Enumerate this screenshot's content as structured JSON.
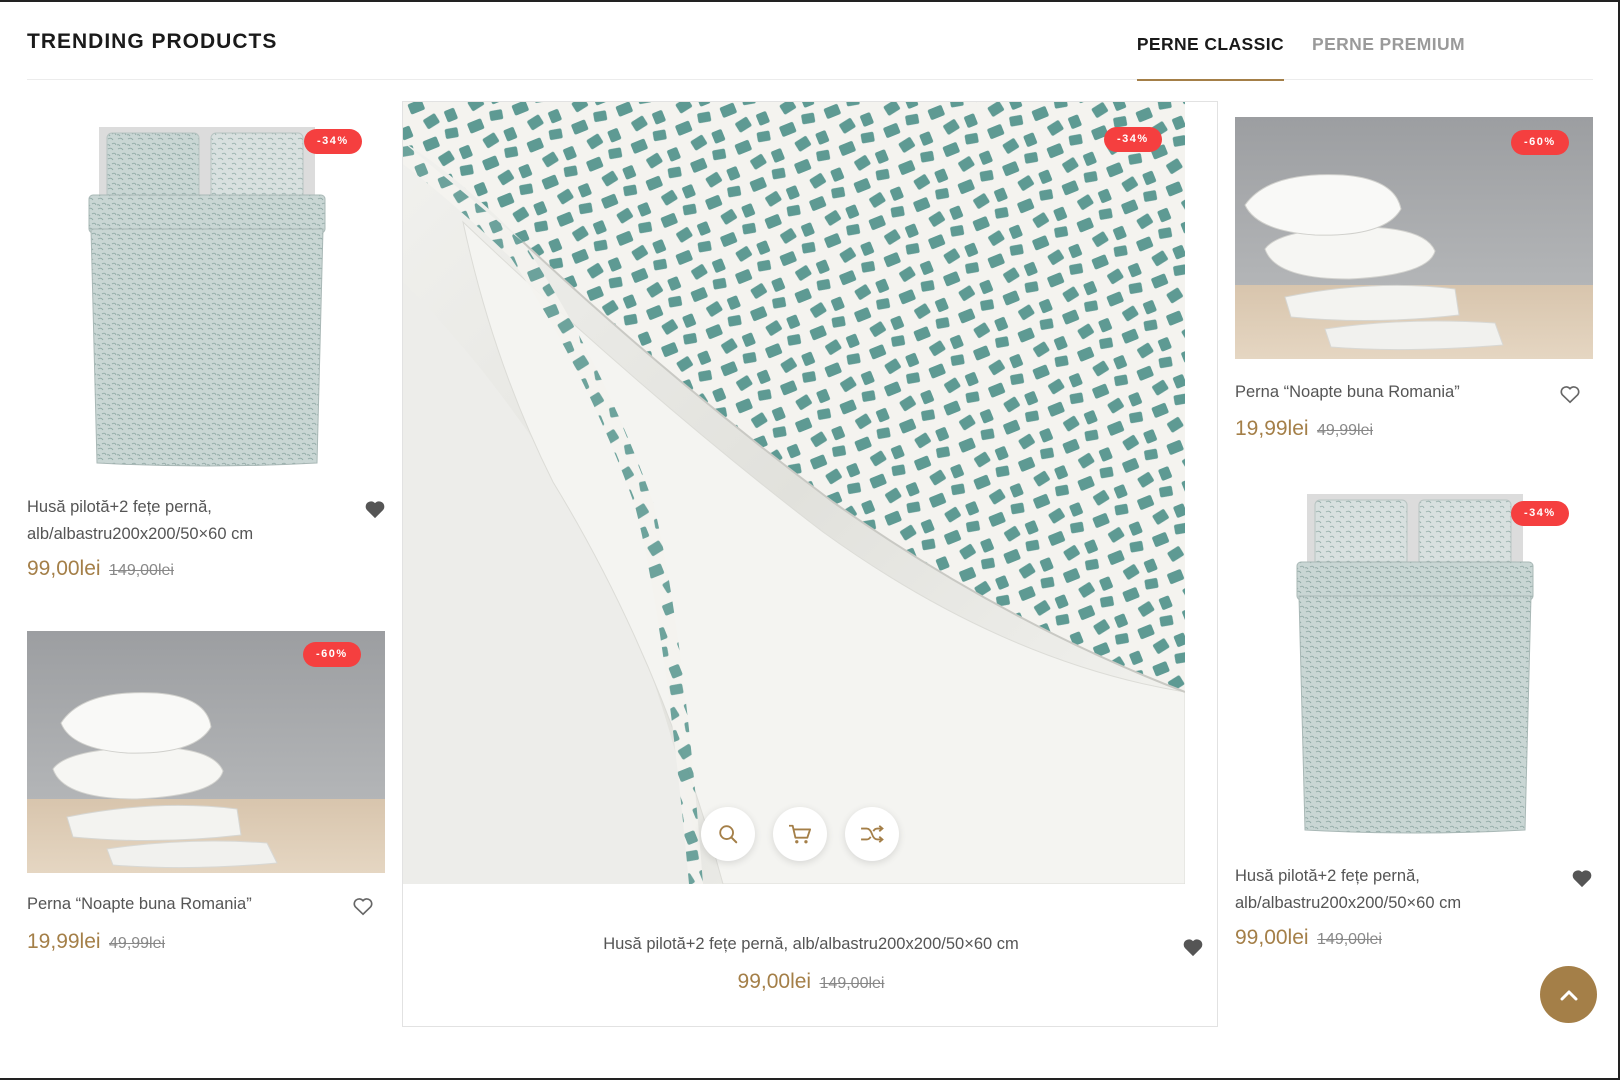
{
  "section": {
    "title": "TRENDING PRODUCTS"
  },
  "tabs": [
    {
      "label": "PERNE CLASSIC",
      "active": true
    },
    {
      "label": "PERNE PREMIUM",
      "active": false
    }
  ],
  "products": {
    "left_top": {
      "badge": "-34%",
      "name_line1": "Husă pilotă+2 fețe pernă,",
      "name_line2": "alb/albastru200x200/50×60 cm",
      "price": "99,00lei",
      "old_price": "149,00lei"
    },
    "left_bottom": {
      "badge": "-60%",
      "name": "Perna “Noapte buna Romania”",
      "price": "19,99lei",
      "old_price": "49,99lei"
    },
    "center": {
      "badge": "-34%",
      "name": "Husă pilotă+2 fețe pernă, alb/albastru200x200/50×60 cm",
      "price": "99,00lei",
      "old_price": "149,00lei"
    },
    "right_top": {
      "badge": "-60%",
      "name": "Perna “Noapte buna Romania”",
      "price": "19,99lei",
      "old_price": "49,99lei"
    },
    "right_bottom": {
      "badge": "-34%",
      "name_line1": "Husă pilotă+2 fețe pernă,",
      "name_line2": "alb/albastru200x200/50×60 cm",
      "price": "99,00lei",
      "old_price": "149,00lei"
    }
  },
  "actions": {
    "quick_view_icon": "search-icon",
    "cart_icon": "cart-icon",
    "compare_icon": "shuffle-icon"
  },
  "colors": {
    "accent": "#a47f48",
    "badge": "#f53f3f",
    "pattern": "#5e9a93"
  }
}
